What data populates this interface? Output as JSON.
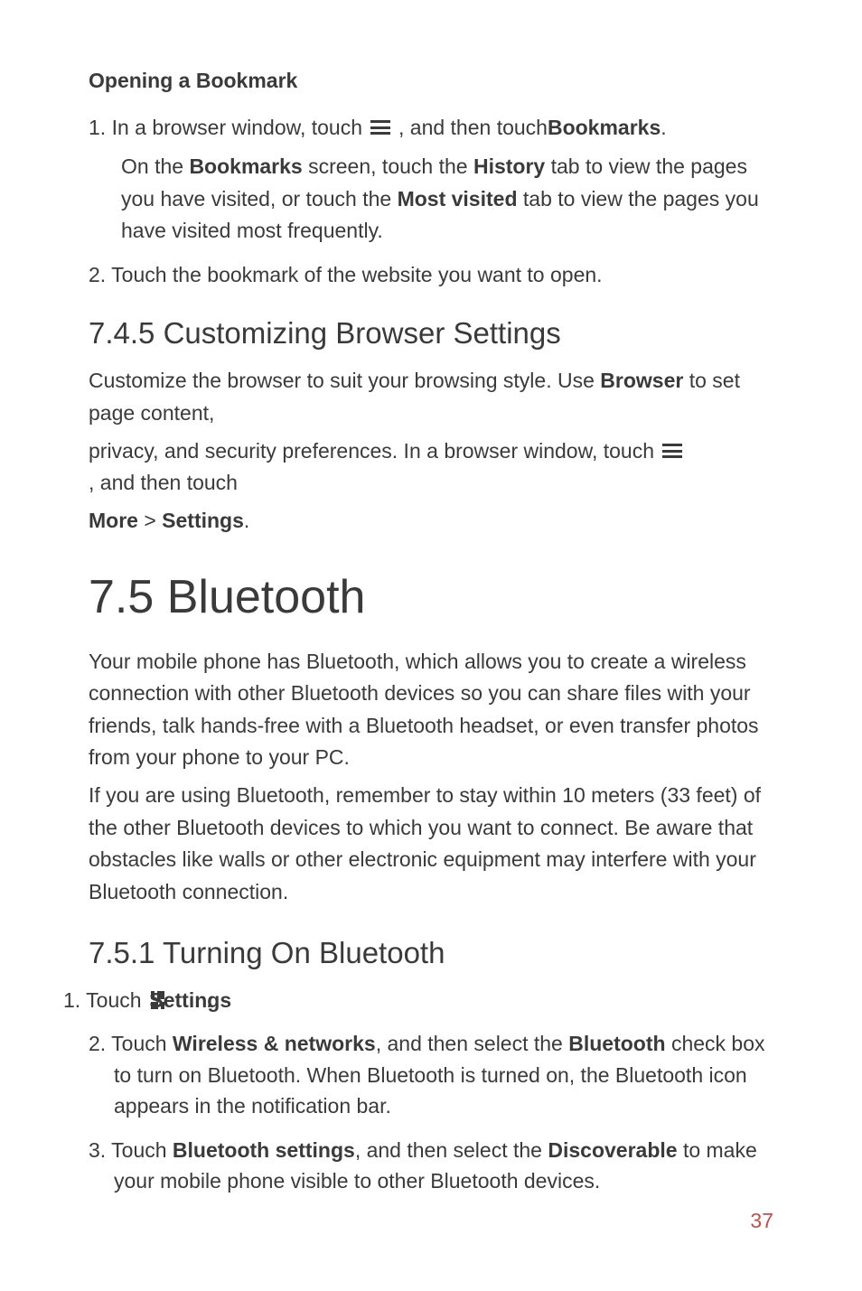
{
  "h4_opening": "Opening a Bookmark",
  "step1": {
    "prefix": "1. In a browser window, touch ",
    "mid": " , and then touch ",
    "bold": "Bookmarks",
    "suffix": "."
  },
  "sub1": {
    "t1": "On the ",
    "b1": "Bookmarks",
    "t2": " screen, touch the ",
    "b2": "History",
    "t3": " tab to view the pages you have visited, or touch the ",
    "b3": "Most visited",
    "t4": " tab to view the pages you have visited most frequently."
  },
  "step2": "2. Touch the bookmark of the website you want to open.",
  "h2_745": "7.4.5  Customizing Browser Settings",
  "p745a": {
    "t1": "Customize the browser to suit your browsing style. Use ",
    "b1": "Browser",
    "t2": " to set page content,"
  },
  "p745b": {
    "t1": "privacy, and security preferences. In a browser window, touch ",
    "t2": " , and then touch "
  },
  "p745c": {
    "b1": "More",
    "t1": " > ",
    "b2": "Settings",
    "t2": "."
  },
  "h1_75": "7.5  Bluetooth",
  "p75a": "Your mobile phone has Bluetooth, which allows you to create a wireless connection with other Bluetooth devices so you can share files with your friends, talk hands-free with a Bluetooth headset, or even transfer photos from your phone to your PC.",
  "p75b": "If you are using Bluetooth, remember to stay within 10 meters (33 feet) of the other Bluetooth devices to which you want to connect. Be aware that obstacles like walls or other electronic equipment may interfere with your Bluetooth connection.",
  "h2_751": "7.5.1  Turning On Bluetooth",
  "li1": {
    "t1": "1. Touch ",
    "t2": " > ",
    "b1": "Settings",
    "t3": "."
  },
  "li2": {
    "t1": "2. Touch ",
    "b1": "Wireless & networks",
    "t2": ", and then select the ",
    "b2": "Bluetooth",
    "t3": " check box to turn on Bluetooth. When Bluetooth is turned on, the Bluetooth icon appears in the notification bar."
  },
  "li3": {
    "t1": "3. Touch ",
    "b1": "Bluetooth settings",
    "t2": ", and then select the ",
    "b2": "Discoverable",
    "t3": " to make your mobile phone visible to other Bluetooth devices."
  },
  "page_num": "37"
}
